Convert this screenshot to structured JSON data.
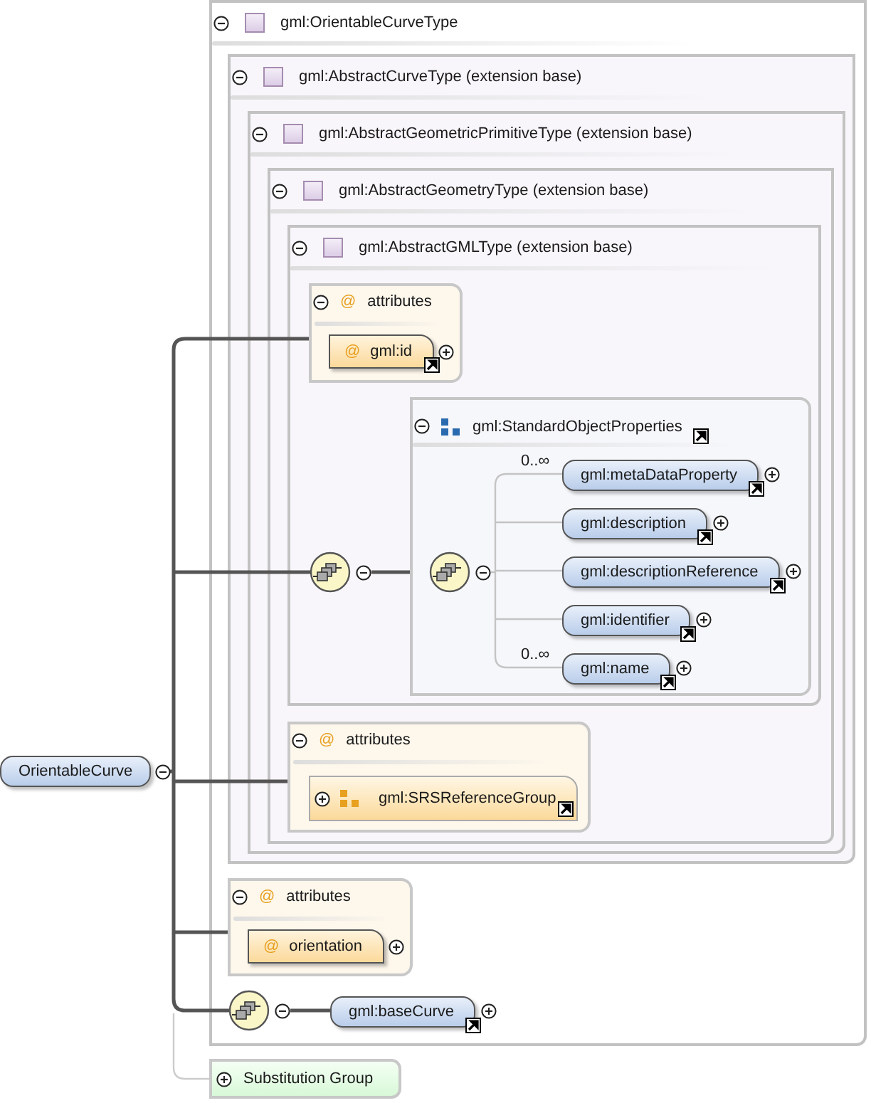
{
  "element": {
    "name": "OrientableCurve",
    "expanded": true
  },
  "type": {
    "name": "gml:OrientableCurveType",
    "expanded": true,
    "base": {
      "name": "gml:AbstractCurveType (extension base)",
      "expanded": true,
      "base": {
        "name": "gml:AbstractGeometricPrimitiveType (extension base)",
        "expanded": true,
        "base": {
          "name": "gml:AbstractGeometryType (extension base)",
          "expanded": true,
          "base": {
            "name": "gml:AbstractGMLType (extension base)",
            "expanded": true,
            "attributes": {
              "marker": "@",
              "label": "attributes",
              "expanded": true,
              "items": [
                {
                  "kind": "attribute",
                  "marker": "@",
                  "name": "gml:id",
                  "reference": true,
                  "expanded": false
                }
              ]
            },
            "sequence": {
              "expanded": true,
              "group": {
                "name": "gml:StandardObjectProperties",
                "reference": true,
                "expanded": true,
                "sequence": {
                  "expanded": true,
                  "elements": [
                    {
                      "name": "gml:metaDataProperty",
                      "occurs": "0..∞",
                      "reference": true,
                      "expanded": false
                    },
                    {
                      "name": "gml:description",
                      "reference": true,
                      "expanded": false
                    },
                    {
                      "name": "gml:descriptionReference",
                      "reference": true,
                      "expanded": false
                    },
                    {
                      "name": "gml:identifier",
                      "reference": true,
                      "expanded": false
                    },
                    {
                      "name": "gml:name",
                      "occurs": "0..∞",
                      "reference": true,
                      "expanded": false
                    }
                  ]
                }
              }
            }
          },
          "attributes": {
            "marker": "@",
            "label": "attributes",
            "expanded": true,
            "items": [
              {
                "kind": "attribute_group",
                "name": "gml:SRSReferenceGroup",
                "reference": true,
                "expanded": false
              }
            ]
          }
        }
      }
    },
    "attributes": {
      "marker": "@",
      "label": "attributes",
      "expanded": true,
      "items": [
        {
          "kind": "attribute",
          "marker": "@",
          "name": "orientation",
          "reference": false,
          "expanded": false
        }
      ]
    },
    "sequence": {
      "expanded": true,
      "elements": [
        {
          "name": "gml:baseCurve",
          "reference": true,
          "expanded": false
        }
      ]
    }
  },
  "substitution_group": {
    "label": "Substitution Group",
    "expanded": false
  }
}
